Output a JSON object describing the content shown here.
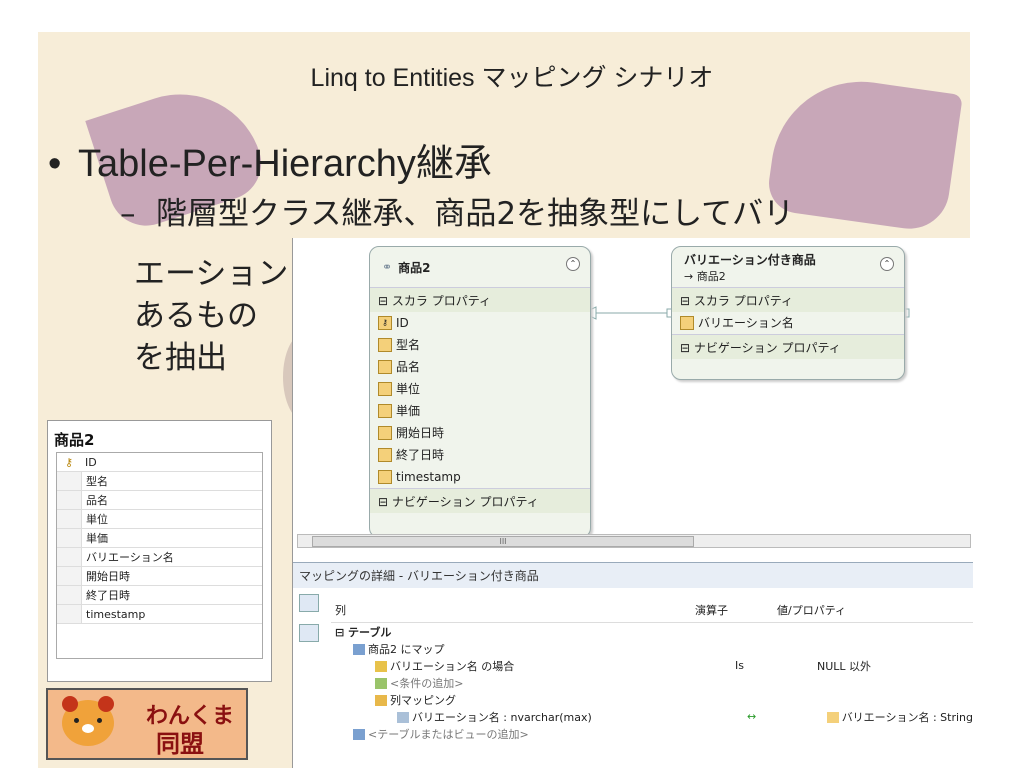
{
  "slide": {
    "title": "Linq to Entities マッピング シナリオ",
    "bullet1": "Table-Per-Hierarchy継承",
    "bullet2_line1": "階層型クラス継承、商品2を抽象型にしてバリ",
    "bullet2_line2": "エーション",
    "bullet2_line3": "あるもの",
    "bullet2_line4": "を抽出"
  },
  "table": {
    "title": "商品2",
    "rows": [
      "ID",
      "型名",
      "品名",
      "単位",
      "単価",
      "バリエーション名",
      "開始日時",
      "終了日時",
      "timestamp"
    ]
  },
  "logo": {
    "text1": "わんくま",
    "text2": "同盟"
  },
  "entity1": {
    "name": "商品2",
    "scalar": "スカラ プロパティ",
    "props": [
      "ID",
      "型名",
      "品名",
      "単位",
      "単価",
      "開始日時",
      "終了日時",
      "timestamp"
    ],
    "nav": "ナビゲーション プロパティ"
  },
  "entity2": {
    "name": "バリエーション付き商品",
    "base": "→ 商品2",
    "scalar": "スカラ プロパティ",
    "props": [
      "バリエーション名"
    ],
    "nav": "ナビゲーション プロパティ"
  },
  "scroll_thumb": "III",
  "mapping": {
    "header": "マッピングの詳細 - バリエーション付き商品",
    "columns": [
      "列",
      "演算子",
      "値/プロパティ"
    ],
    "rows": [
      {
        "c1": "⊟ テーブル",
        "c2": "",
        "c3": ""
      },
      {
        "c1": "商品2 にマップ",
        "c2": "",
        "c3": ""
      },
      {
        "c1": "バリエーション名 の場合",
        "c2": "Is",
        "c3": "NULL 以外"
      },
      {
        "c1": "<条件の追加>",
        "c2": "",
        "c3": ""
      },
      {
        "c1": "列マッピング",
        "c2": "",
        "c3": ""
      },
      {
        "c1": "バリエーション名 : nvarchar(max)",
        "c2": "↔",
        "c3": "バリエーション名 : String"
      },
      {
        "c1": "<テーブルまたはビューの追加>",
        "c2": "",
        "c3": ""
      }
    ]
  },
  "colors": {
    "background": "#f7edd8",
    "accent": "#c8a7b8",
    "entity_fill": "#f0f4ec"
  }
}
